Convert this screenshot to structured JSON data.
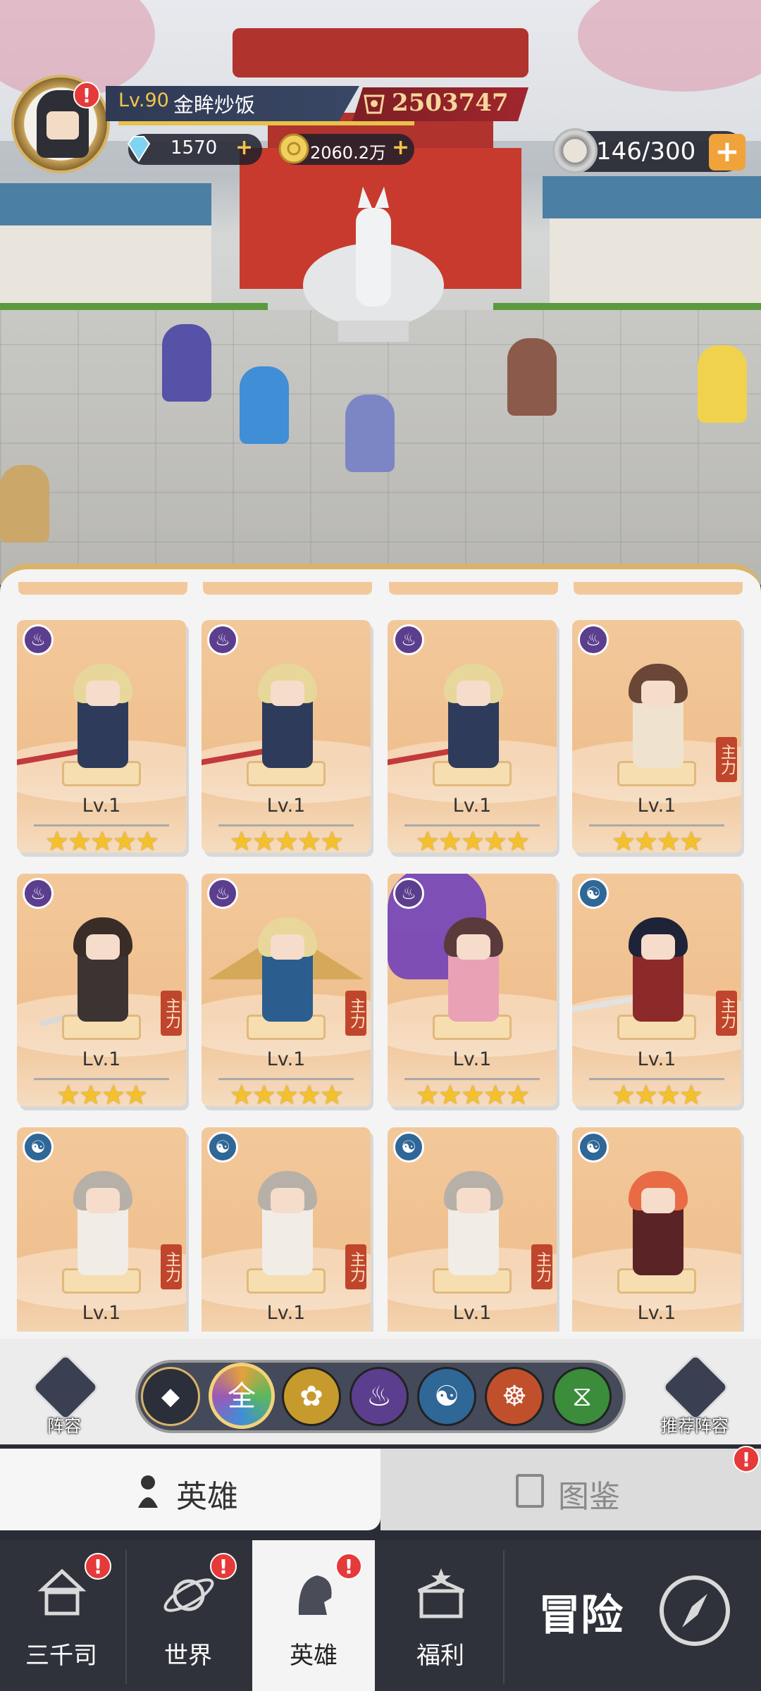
{
  "player": {
    "level": "Lv.90",
    "name": "金眸炒饭",
    "power": "2503747",
    "diamonds": "1570",
    "gold": "2060.2万",
    "stamina": "146/300"
  },
  "alerts": {
    "mark": "!"
  },
  "heroes": [
    {
      "level": "Lv.1",
      "stars": "★★★★★",
      "element": "fire",
      "tag": ""
    },
    {
      "level": "Lv.1",
      "stars": "★★★★★",
      "element": "fire",
      "tag": ""
    },
    {
      "level": "Lv.1",
      "stars": "★★★★★",
      "element": "fire",
      "tag": ""
    },
    {
      "level": "Lv.1",
      "stars": "★★★★",
      "element": "fire",
      "tag": "主力"
    },
    {
      "level": "Lv.1",
      "stars": "★★★★",
      "element": "fire",
      "tag": "主力"
    },
    {
      "level": "Lv.1",
      "stars": "★★★★★",
      "element": "fire",
      "tag": "主力"
    },
    {
      "level": "Lv.1",
      "stars": "★★★★★",
      "element": "fire",
      "tag": ""
    },
    {
      "level": "Lv.1",
      "stars": "★★★★",
      "element": "water",
      "tag": "主力"
    },
    {
      "level": "Lv.1",
      "stars": "",
      "element": "water",
      "tag": "主力"
    },
    {
      "level": "Lv.1",
      "stars": "",
      "element": "water",
      "tag": "主力"
    },
    {
      "level": "Lv.1",
      "stars": "",
      "element": "water",
      "tag": "主力"
    },
    {
      "level": "Lv.1",
      "stars": "",
      "element": "water",
      "tag": ""
    }
  ],
  "filters": {
    "formation": "阵容",
    "all": "全",
    "recommend": "推荐阵容"
  },
  "tabs": {
    "heroes": "英雄",
    "codex": "图鉴"
  },
  "nav": [
    {
      "label": "三千司"
    },
    {
      "label": "世界"
    },
    {
      "label": "英雄"
    },
    {
      "label": "福利"
    }
  ],
  "adventure": "冒险",
  "colors": {
    "accent": "#f0a23b",
    "panel_gold": "#d8b46a",
    "fire": "#5b3e8e",
    "water": "#2f6796",
    "star": "#f5c12b"
  }
}
